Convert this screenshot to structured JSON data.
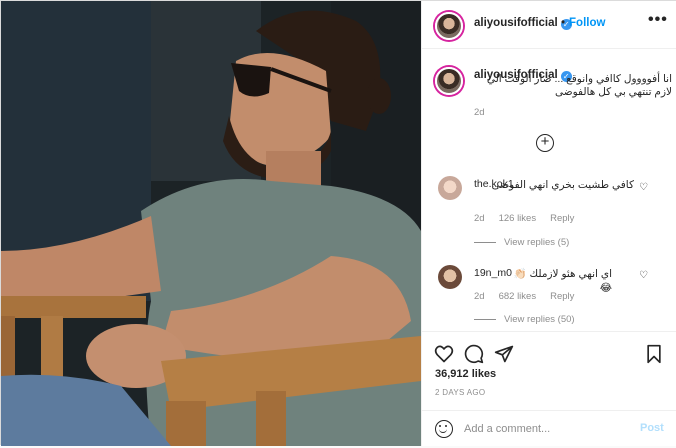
{
  "post": {
    "username": "aliyousifofficial",
    "verified": true,
    "follow_separator": "•",
    "follow_label": "Follow",
    "more_icon": "more-horizontal-icon",
    "more_label": "•••",
    "caption_text": "انا أفوووول كاافي وانوقع ... صار الوقت الي لازم تنتهي بي كل هالفوضى",
    "caption_time": "2d",
    "load_more_label": "+",
    "likes": "36,912 likes",
    "time_ago": "2 DAYS AGO",
    "comment_placeholder": "Add a comment...",
    "post_label": "Post"
  },
  "comments": [
    {
      "username": "the.kok1",
      "text": "كافي طشيت بخري انهي الفوضى",
      "time": "2d",
      "likes": "126 likes",
      "reply_label": "Reply",
      "view_replies": "View replies (5)"
    },
    {
      "username": "19n_m0",
      "text": "اي انهي هئو لازملك 👏🏻😂",
      "time": "2d",
      "likes": "682 likes",
      "reply_label": "Reply",
      "view_replies": "View replies (50)"
    }
  ],
  "colors": {
    "accent": "#0095f6",
    "verified": "#3897f0",
    "muted": "#8e8e8e",
    "post_disabled": "#b2dffc"
  },
  "icons": [
    "heart-icon",
    "comment-icon",
    "share-icon",
    "bookmark-icon",
    "emoji-icon",
    "verified-badge-icon",
    "plus-circle-icon"
  ]
}
